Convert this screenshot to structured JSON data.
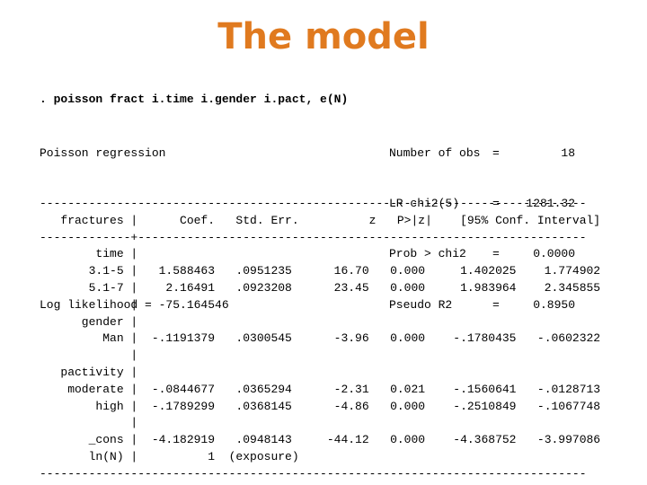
{
  "title": "The model",
  "command": ". poisson fract i.time i.gender i.pact, e(N)",
  "header": {
    "model_name": "Poisson regression",
    "log_likelihood_label": "Log likelihood",
    "log_likelihood_value": "-75.164546",
    "stats": [
      {
        "label": "Number of obs",
        "eq": "=",
        "value": "18"
      },
      {
        "label": "LR chi2(5)",
        "eq": "=",
        "value": "1281.32"
      },
      {
        "label": "Prob > chi2",
        "eq": "=",
        "value": "0.0000"
      },
      {
        "label": "Pseudo R2",
        "eq": "=",
        "value": "0.8950"
      }
    ]
  },
  "table": {
    "depvar": "fractures",
    "columns": [
      "Coef.",
      "Std. Err.",
      "z",
      "P>|z|",
      "[95% Conf. Interval]"
    ],
    "rows": [
      {
        "label": "time",
        "type": "group"
      },
      {
        "label": "3.1-5",
        "coef": "1.588463",
        "se": ".0951235",
        "z": "16.70",
        "p": "0.000",
        "ci_low": "1.402025",
        "ci_high": "1.774902"
      },
      {
        "label": "5.1-7",
        "coef": "2.16491",
        "se": ".0923208",
        "z": "23.45",
        "p": "0.000",
        "ci_low": "1.983964",
        "ci_high": "2.345855"
      },
      {
        "label": "",
        "type": "blank"
      },
      {
        "label": "gender",
        "type": "group"
      },
      {
        "label": "Man",
        "coef": "-.1191379",
        "se": ".0300545",
        "z": "-3.96",
        "p": "0.000",
        "ci_low": "-.1780435",
        "ci_high": "-.0602322"
      },
      {
        "label": "",
        "type": "blank"
      },
      {
        "label": "pactivity",
        "type": "group"
      },
      {
        "label": "moderate",
        "coef": "-.0844677",
        "se": ".0365294",
        "z": "-2.31",
        "p": "0.021",
        "ci_low": "-.1560641",
        "ci_high": "-.0128713"
      },
      {
        "label": "high",
        "coef": "-.1789299",
        "se": ".0368145",
        "z": "-4.86",
        "p": "0.000",
        "ci_low": "-.2510849",
        "ci_high": "-.1067748"
      },
      {
        "label": "",
        "type": "blank"
      },
      {
        "label": "_cons",
        "coef": "-4.182919",
        "se": ".0948143",
        "z": "-44.12",
        "p": "0.000",
        "ci_low": "-4.368752",
        "ci_high": "-3.997086"
      },
      {
        "label": "ln(N)",
        "coef": "1",
        "se": "(exposure)",
        "type": "exposure"
      }
    ]
  }
}
